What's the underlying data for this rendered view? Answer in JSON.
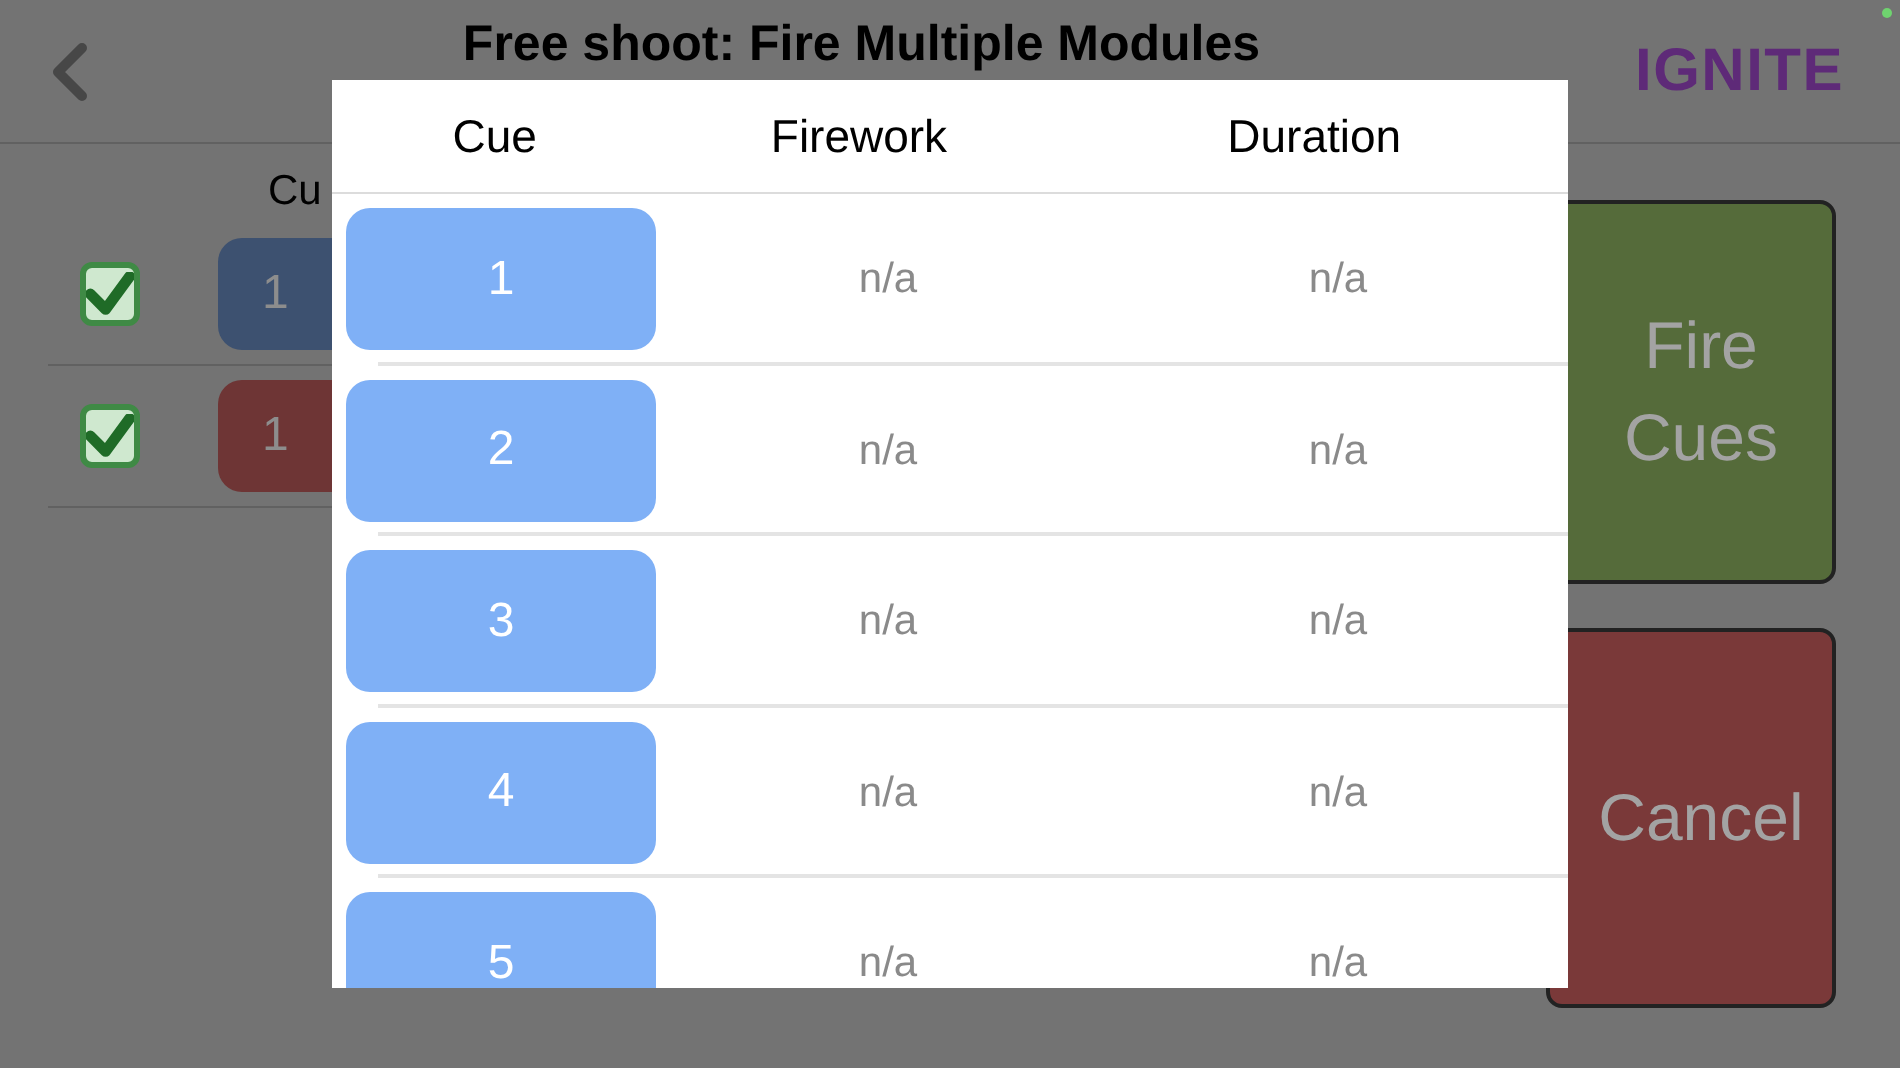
{
  "title": "Free shoot: Fire Multiple Modules",
  "logo": "IGNITE",
  "background_table": {
    "column_header": "Cu",
    "rows": [
      {
        "checked": true,
        "cue": "1",
        "color": "#3d5170"
      },
      {
        "checked": true,
        "cue": "1",
        "color": "#6e3535"
      }
    ]
  },
  "actions": [
    {
      "label": "Fire Cues",
      "kind": "fire"
    },
    {
      "label": "Cancel",
      "kind": "cancel"
    }
  ],
  "modal": {
    "columns": [
      "Cue",
      "Firework",
      "Duration"
    ],
    "rows": [
      {
        "cue": "1",
        "firework": "n/a",
        "duration": "n/a"
      },
      {
        "cue": "2",
        "firework": "n/a",
        "duration": "n/a"
      },
      {
        "cue": "3",
        "firework": "n/a",
        "duration": "n/a"
      },
      {
        "cue": "4",
        "firework": "n/a",
        "duration": "n/a"
      },
      {
        "cue": "5",
        "firework": "n/a",
        "duration": "n/a"
      }
    ]
  }
}
